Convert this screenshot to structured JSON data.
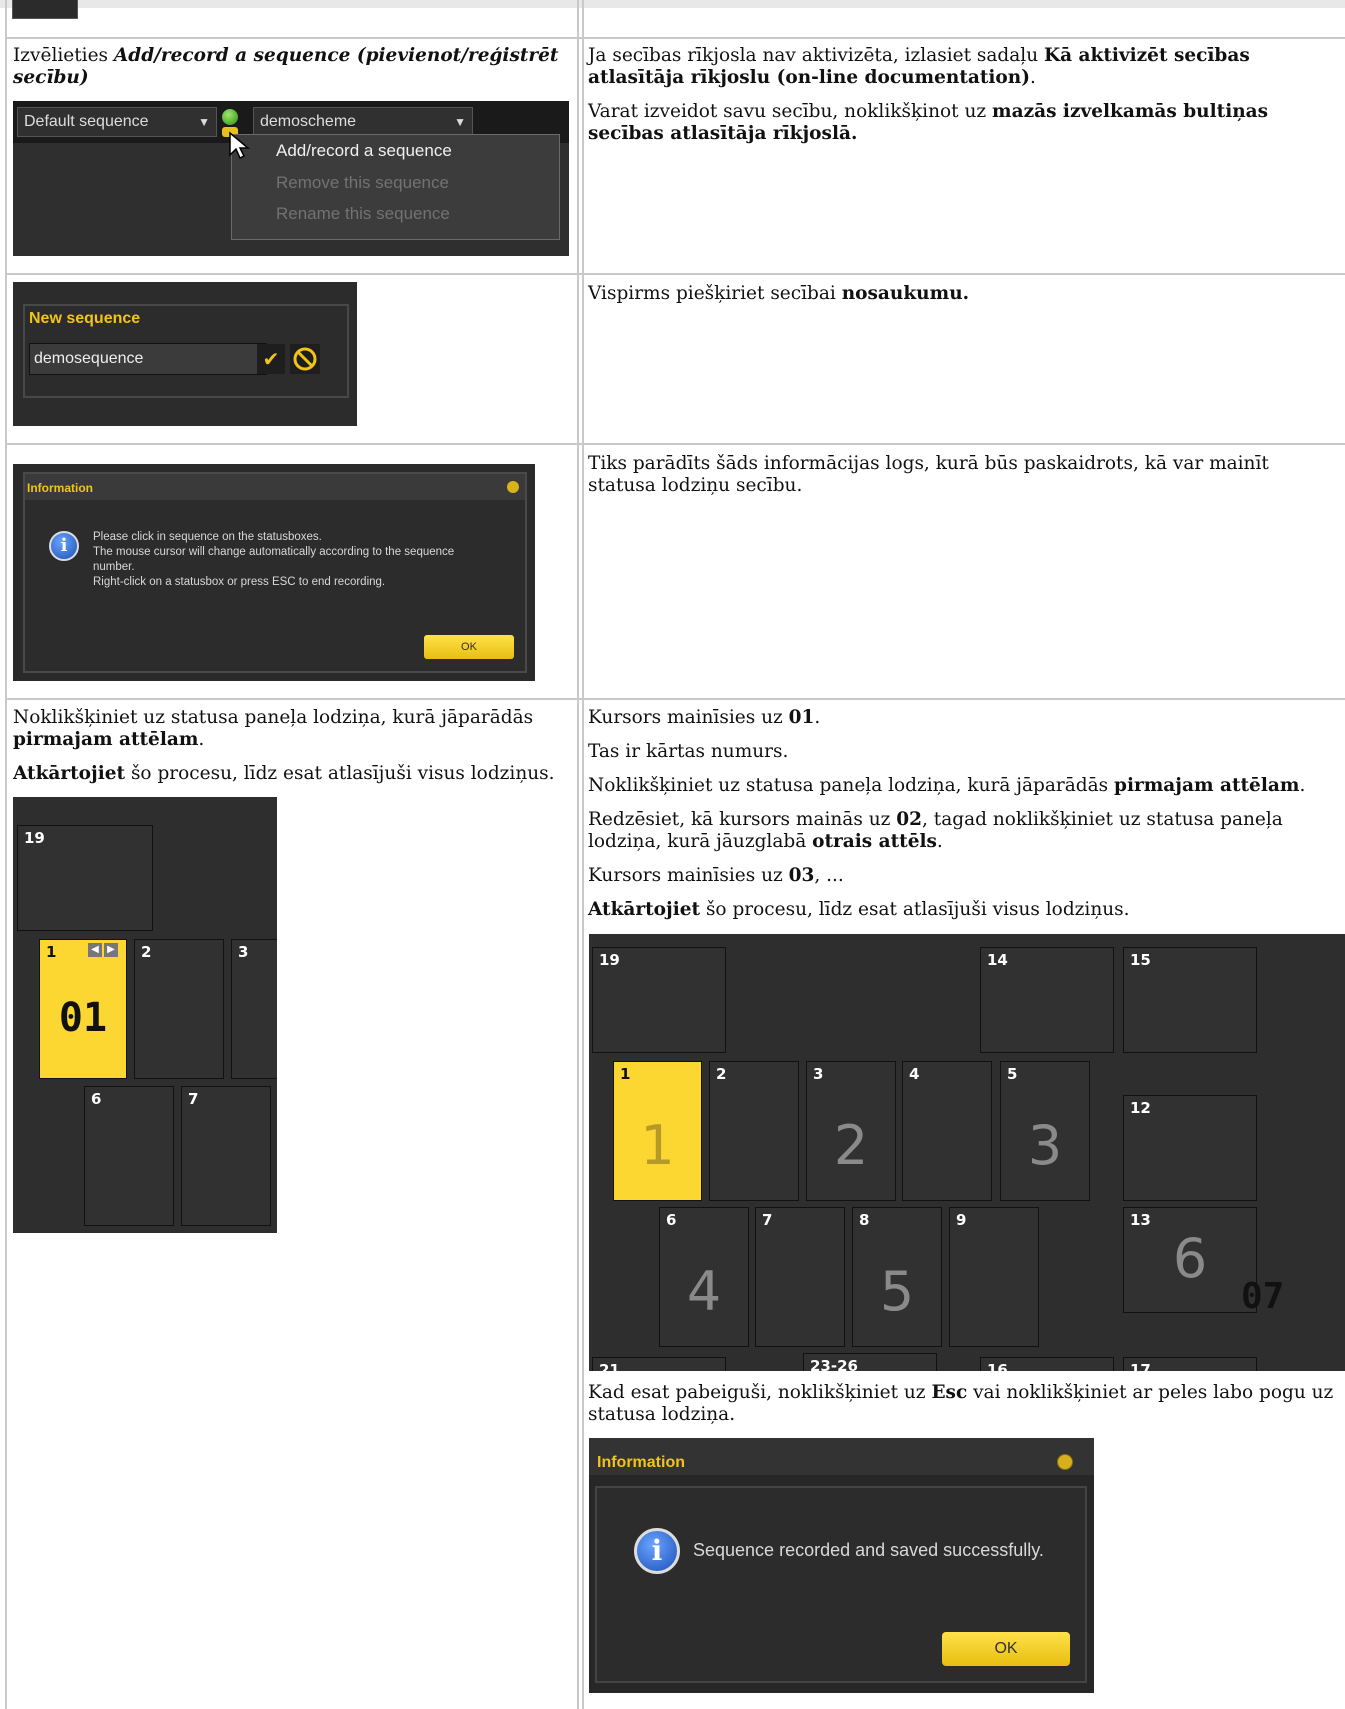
{
  "row1": {
    "left_intro": "Izvēlieties ",
    "left_bold": "Add/record a sequence (pievienot/reģistrēt secību)",
    "right_p1_a": "Ja secības rīkjosla nav aktivizēta, izlasiet sadaļu ",
    "right_p1_b": "Kā aktivizēt secības atlasītāja rīkjoslu (on-line documentation)",
    "right_p1_c": ".",
    "right_p2_a": "Varat izveidot savu secību, noklikšķinot uz ",
    "right_p2_b": "mazās izvelkamās bultiņas secības atlasītāja rīkjoslā.",
    "shot": {
      "dropdown1": "Default sequence",
      "dropdown2": "demoscheme",
      "menu": [
        "Add/record a sequence",
        "Remove this sequence",
        "Rename this sequence"
      ]
    }
  },
  "row2": {
    "right_a": "Vispirms piešķiriet secībai ",
    "right_b": "nosaukumu.",
    "shot": {
      "title": "New sequence",
      "value": "demosequence",
      "ok_icon": "check-icon",
      "cancel_icon": "cancel-icon"
    }
  },
  "row3": {
    "right": "Tiks parādīts šāds informācijas logs, kurā būs paskaidrots, kā var mainīt statusa lodziņu secību.",
    "shot": {
      "title": "Information",
      "lines": [
        "Please click in sequence on the statusboxes.",
        "The mouse cursor will change automatically according to the sequence number.",
        "Right-click on a statusbox or press ESC to end recording."
      ],
      "ok": "OK"
    }
  },
  "row4": {
    "left_p1_a": "Noklikšķiniet uz statusa paneļa lodziņa, kurā jāparādās ",
    "left_p1_b": "pirmajam attēlam",
    "left_p1_c": ".",
    "left_p2_a": "Atkārtojiet",
    "left_p2_b": " šo procesu, līdz esat atlasījuši visus lodziņus.",
    "left_shot": {
      "labels": [
        "19",
        "1",
        "2",
        "3",
        "6",
        "7"
      ],
      "cursor_text": "01"
    },
    "right_p1_a": "Kursors mainīsies uz ",
    "right_p1_b": "01",
    "right_p1_c": ".",
    "right_p2": "Tas ir kārtas numurs.",
    "right_p3_a": "Noklikšķiniet uz statusa paneļa lodziņa, kurā jāparādās ",
    "right_p3_b": "pirmajam attēlam",
    "right_p3_c": ".",
    "right_p4_a": "Redzēsiet, kā kursors mainās uz ",
    "right_p4_b": "02",
    "right_p4_c": ", tagad noklikšķiniet uz statusa paneļa lodziņa, kurā jāuzglabā ",
    "right_p4_d": "otrais attēls",
    "right_p4_e": ".",
    "right_p5_a": "Kursors mainīsies uz ",
    "right_p5_b": "03",
    "right_p5_c": ", ...",
    "right_p6_a": "Atkārtojiet",
    "right_p6_b": " šo procesu, līdz esat atlasījuši visus lodziņus.",
    "right_shot": {
      "tiles": [
        {
          "n": "19",
          "big": ""
        },
        {
          "n": "14",
          "big": ""
        },
        {
          "n": "15",
          "big": ""
        },
        {
          "n": "1",
          "big": "1"
        },
        {
          "n": "2",
          "big": ""
        },
        {
          "n": "3",
          "big": "2"
        },
        {
          "n": "4",
          "big": ""
        },
        {
          "n": "5",
          "big": "3"
        },
        {
          "n": "12",
          "big": ""
        },
        {
          "n": "6",
          "big": "4"
        },
        {
          "n": "7",
          "big": ""
        },
        {
          "n": "8",
          "big": "5"
        },
        {
          "n": "9",
          "big": ""
        },
        {
          "n": "13",
          "big": "6"
        },
        {
          "n": "21",
          "big": ""
        },
        {
          "n": "23-26",
          "big": ""
        },
        {
          "n": "16",
          "big": ""
        },
        {
          "n": "17",
          "big": ""
        }
      ],
      "cursor_text": "07"
    },
    "right_p7_a": "Kad esat pabeiguši, noklikšķiniet uz ",
    "right_p7_b": "Esc",
    "right_p7_c": " vai noklikšķiniet ar peles labo pogu uz statusa lodziņa.",
    "dialog": {
      "title": "Information",
      "message": "Sequence recorded and saved successfully.",
      "ok": "OK"
    }
  },
  "colors": {
    "accent_yellow": "#fcd731",
    "dark_bg": "#2e2e2e",
    "border": "#c9c9c9"
  }
}
